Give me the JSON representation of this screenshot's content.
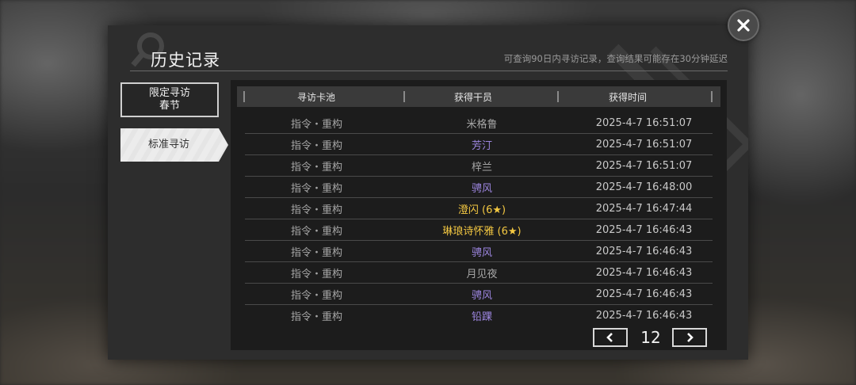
{
  "header": {
    "title": "历史记录",
    "subtitle": "可查询90日内寻访记录，查询结果可能存在30分钟延迟"
  },
  "sidebar": {
    "limited_label_line1": "限定寻访",
    "limited_label_line2": "春节",
    "standard_label": "标准寻访"
  },
  "table": {
    "columns": [
      "寻访卡池",
      "获得干员",
      "获得时间"
    ],
    "rows": [
      {
        "pool": "指令・重构",
        "operator": "米格鲁",
        "time": "2025-4-7 16:51:07",
        "rarity": 3
      },
      {
        "pool": "指令・重构",
        "operator": "芳汀",
        "time": "2025-4-7 16:51:07",
        "rarity": 4
      },
      {
        "pool": "指令・重构",
        "operator": "梓兰",
        "time": "2025-4-7 16:51:07",
        "rarity": 3
      },
      {
        "pool": "指令・重构",
        "operator": "骋风",
        "time": "2025-4-7 16:48:00",
        "rarity": 4
      },
      {
        "pool": "指令・重构",
        "operator": "澄闪 (6★)",
        "time": "2025-4-7 16:47:44",
        "rarity": 6
      },
      {
        "pool": "指令・重构",
        "operator": "琳琅诗怀雅 (6★)",
        "time": "2025-4-7 16:46:43",
        "rarity": 6
      },
      {
        "pool": "指令・重构",
        "operator": "骋风",
        "time": "2025-4-7 16:46:43",
        "rarity": 4
      },
      {
        "pool": "指令・重构",
        "operator": "月见夜",
        "time": "2025-4-7 16:46:43",
        "rarity": 3
      },
      {
        "pool": "指令・重构",
        "operator": "骋风",
        "time": "2025-4-7 16:46:43",
        "rarity": 4
      },
      {
        "pool": "指令・重构",
        "operator": "铅踝",
        "time": "2025-4-7 16:46:43",
        "rarity": 4
      }
    ]
  },
  "pager": {
    "page": "12",
    "prev_icon": "chevron-left-icon",
    "next_icon": "chevron-right-icon"
  },
  "close_icon": "close-icon",
  "colors": {
    "rarity3": "#a6a6a6",
    "rarity4": "#9d86e0",
    "rarity6": "#f4c842"
  }
}
